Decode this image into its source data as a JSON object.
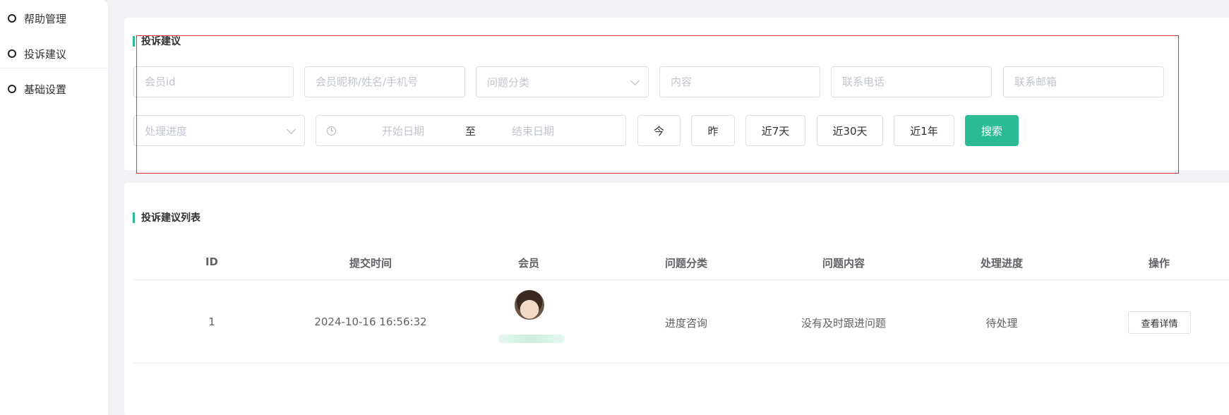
{
  "sidebar": {
    "items": [
      {
        "label": "帮助管理"
      },
      {
        "label": "投诉建议"
      },
      {
        "label": "基础设置"
      }
    ]
  },
  "filter": {
    "title": "投诉建议",
    "member_id_placeholder": "会员id",
    "member_name_placeholder": "会员昵称/姓名/手机号",
    "category_placeholder": "问题分类",
    "content_placeholder": "内容",
    "phone_placeholder": "联系电话",
    "email_placeholder": "联系邮箱",
    "progress_placeholder": "处理进度",
    "start_date_placeholder": "开始日期",
    "date_separator": "至",
    "end_date_placeholder": "结束日期",
    "quick_ranges": [
      "今",
      "昨",
      "近7天",
      "近30天",
      "近1年"
    ],
    "search_label": "搜索"
  },
  "list": {
    "title": "投诉建议列表",
    "columns": [
      "ID",
      "提交时间",
      "会员",
      "问题分类",
      "问题内容",
      "处理进度",
      "操作"
    ],
    "rows": [
      {
        "id": "1",
        "submit_time": "2024-10-16 16:56:32",
        "category": "进度咨询",
        "content": "没有及时跟进问题",
        "progress": "待处理",
        "action_label": "查看详情"
      }
    ]
  },
  "colors": {
    "accent": "#2bbc95",
    "highlight_border": "#e0323c"
  }
}
